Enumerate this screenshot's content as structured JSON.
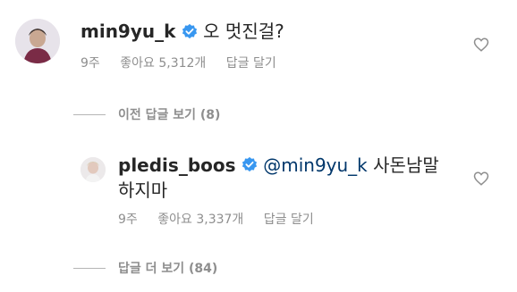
{
  "comment1": {
    "username": "min9yu_k",
    "text": "오 멋진걸?",
    "time": "9주",
    "likes": "좋아요 5,312개",
    "reply_label": "답글 달기"
  },
  "prev_replies_label": "이전 답글 보기 (8)",
  "comment2": {
    "username": "pledis_boos",
    "mention": "@min9yu_k",
    "text_line1": "사돈남말",
    "text_line2": "하지마",
    "time": "9주",
    "likes": "좋아요 3,337개",
    "reply_label": "답글 달기"
  },
  "more_replies_label": "답글 더 보기 (84)",
  "colors": {
    "verified": "#3897f0",
    "mention": "#00376b",
    "secondary_text": "#8e8e8e"
  }
}
